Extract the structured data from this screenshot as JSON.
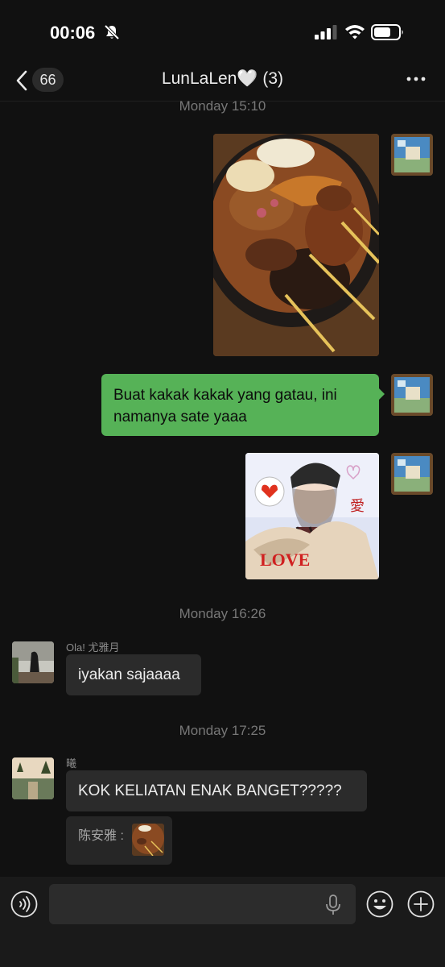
{
  "status_bar": {
    "time": "00:06"
  },
  "header": {
    "back_count": "66",
    "title": "LunLaLen🤍 (3)"
  },
  "messages": {
    "ts1": "Monday 15:10",
    "out_text": "Buat kakak kakak yang gatau, ini namanya sate yaaa",
    "ts2": "Monday 16:26",
    "sender1": "Ola! 尤雅月",
    "in_text1": "iyakan sajaaaa",
    "ts3": "Monday 17:25",
    "sender2": "曦",
    "in_text2": "KOK KELIATAN ENAK BANGET?????",
    "quote_sender": "陈安雅 :"
  },
  "sticker": {
    "love": "LOVE",
    "ai": "愛"
  },
  "colors": {
    "accent_green": "#56b257",
    "background": "#111111",
    "bubble_dark": "#2b2b2b"
  }
}
